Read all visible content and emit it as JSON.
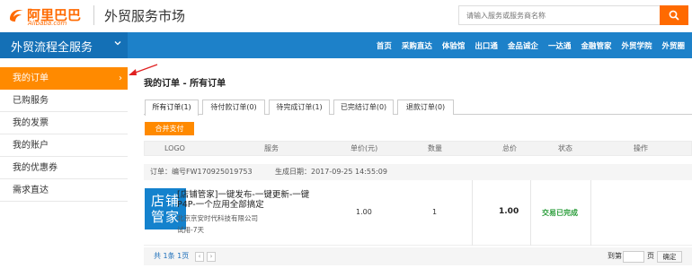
{
  "header": {
    "logo_cn": "阿里巴巴",
    "logo_en": "Alibaba.com",
    "site_title": "外贸服务市场",
    "search_placeholder": "请输入服务或服务商名称",
    "brand_color": "#ff6a00"
  },
  "nav": {
    "brand": "外贸流程全服务",
    "links": [
      "首页",
      "采购直达",
      "体验馆",
      "出口通",
      "金品诚企",
      "一达通",
      "金融管家",
      "外贸学院",
      "外贸圈"
    ],
    "bg_color": "#1d81c9"
  },
  "sidebar": {
    "items": [
      {
        "label": "我的订单",
        "active": true
      },
      {
        "label": "已购服务"
      },
      {
        "label": "我的发票"
      },
      {
        "label": "我的账户"
      },
      {
        "label": "我的优惠券"
      },
      {
        "label": "需求直达"
      }
    ],
    "active_color": "#ff8a00"
  },
  "main": {
    "breadcrumb": "我的订单 - 所有订单",
    "tabs": [
      "所有订单(1)",
      "待付款订单(0)",
      "待完成订单(1)",
      "已完结订单(0)",
      "退款订单(0)"
    ],
    "merge_pay": "合并支付",
    "columns": [
      "LOGO",
      "服务",
      "单价(元)",
      "数量",
      "总价",
      "状态",
      "操作"
    ],
    "order": {
      "number": "订单：编号FW170925019753",
      "created": "生成日期：2017-09-25 14:55:09",
      "thumb_text_line1": "店铺",
      "thumb_text_line2": "管家",
      "product_name": "[店铺管家]一键发布-一键更新-一键P4P-一个应用全部搞定",
      "vendor": "北京京安时代科技有限公司",
      "trial": "试用-7天",
      "unit_price": "1.00",
      "quantity": "1",
      "total": "1.00",
      "status": "交易已完成",
      "status_color": "#2a9d3a"
    },
    "pager": {
      "total": "共 1条 1页",
      "prev": "‹",
      "next": "›",
      "goto_label": "到第",
      "page_unit": "页",
      "confirm": "确定"
    }
  }
}
